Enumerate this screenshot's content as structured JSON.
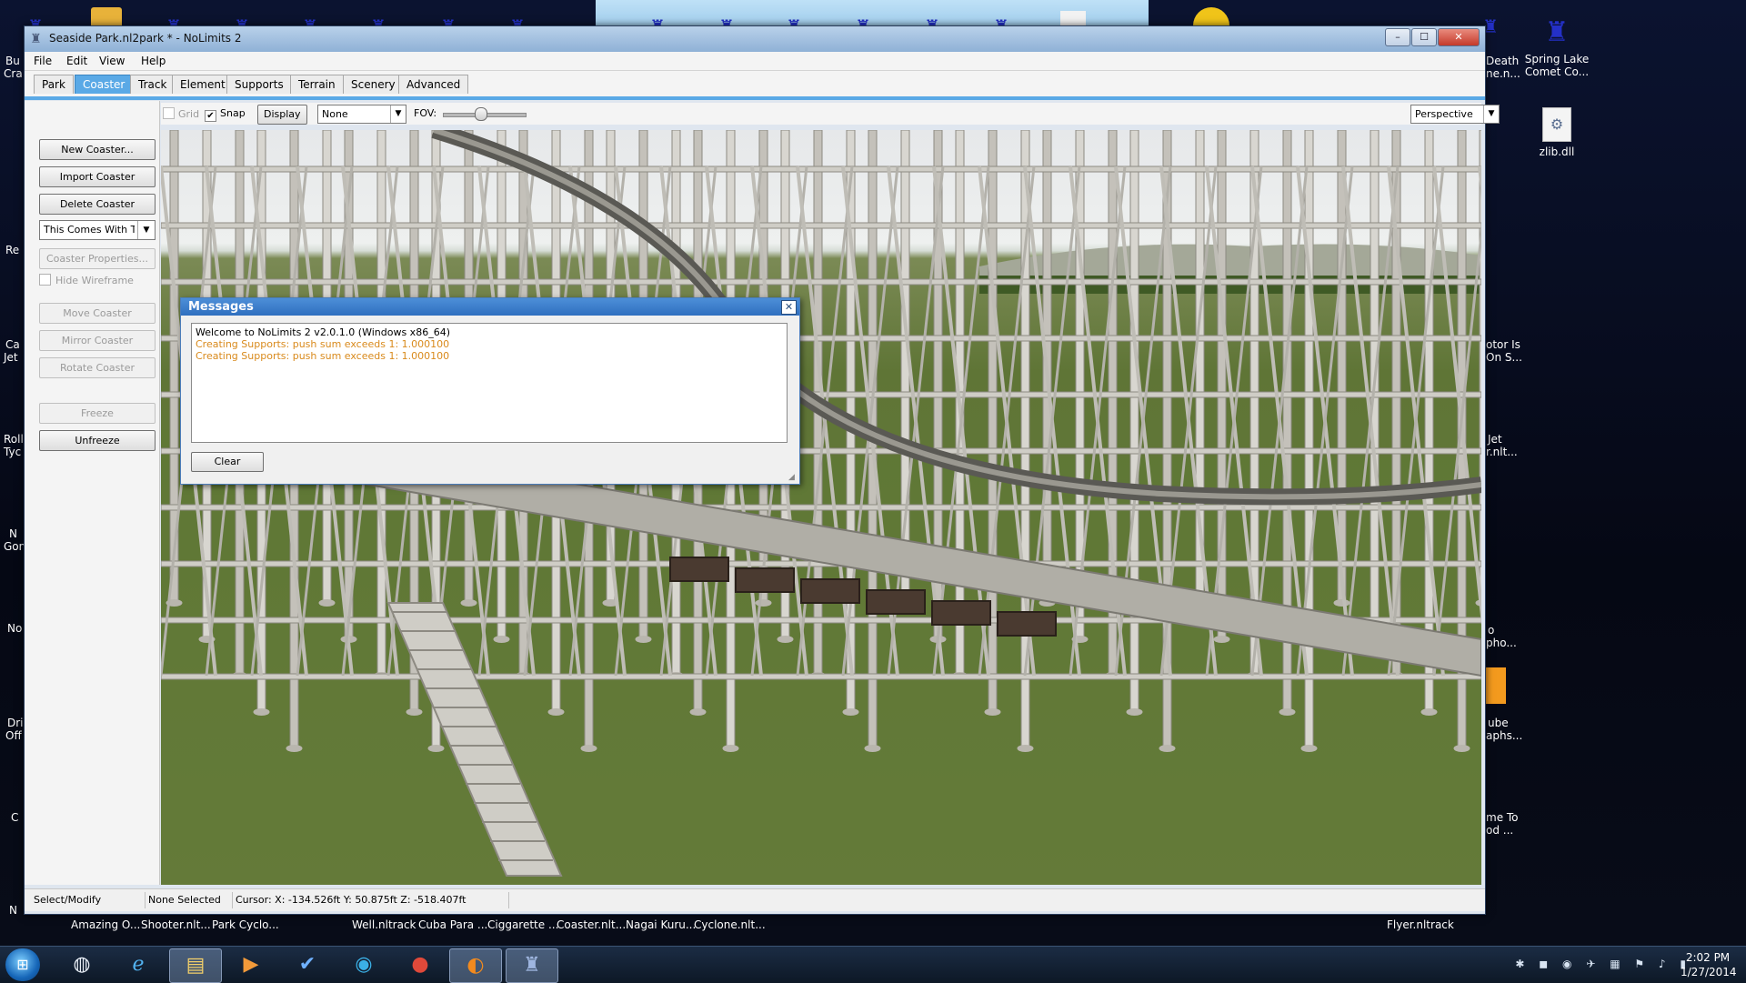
{
  "window": {
    "title": "Seaside Park.nl2park * - NoLimits 2"
  },
  "menu": [
    "File",
    "Edit",
    "View",
    "Help"
  ],
  "tabs": [
    {
      "label": "Park"
    },
    {
      "label": "Coaster",
      "active": true
    },
    {
      "label": "Track"
    },
    {
      "label": "Element"
    },
    {
      "label": "Supports"
    },
    {
      "label": "Terrain"
    },
    {
      "label": "Scenery"
    },
    {
      "label": "Advanced"
    }
  ],
  "left_panel": {
    "new_coaster": "New Coaster...",
    "import_coaster": "Import Coaster",
    "delete_coaster": "Delete Coaster",
    "coaster_select": "This Comes With T",
    "coaster_properties": "Coaster Properties...",
    "hide_wireframe": "Hide Wireframe",
    "move_coaster": "Move Coaster",
    "mirror_coaster": "Mirror Coaster",
    "rotate_coaster": "Rotate Coaster",
    "freeze": "Freeze",
    "unfreeze": "Unfreeze"
  },
  "viewport_toolbar": {
    "grid_label": "Grid",
    "grid_checked": false,
    "snap_label": "Snap",
    "snap_checked": true,
    "display_button": "Display",
    "none_select": "None",
    "fov_label": "FOV:",
    "fov_value": 0.45,
    "view_select": "Perspective"
  },
  "messages": {
    "title": "Messages",
    "lines": [
      {
        "text": "Welcome to NoLimits 2 v2.0.1.0 (Windows x86_64)",
        "type": "normal"
      },
      {
        "text": "Creating Supports: push sum exceeds 1: 1.000100",
        "type": "warn"
      },
      {
        "text": "Creating Supports: push sum exceeds 1: 1.000100",
        "type": "warn"
      }
    ],
    "clear_button": "Clear"
  },
  "status_bar": {
    "mode": "Select/Modify",
    "selection": "None Selected",
    "cursor": "Cursor:  X:  -134.526ft  Y:  50.875ft  Z:  -518.407ft"
  },
  "desktop": {
    "icons_right": [
      {
        "label": "Spring Lake Comet Co...",
        "icon": "castle-icon"
      },
      {
        "label": "zlib.dll",
        "icon": "dll-file-icon"
      }
    ],
    "partial_labels_right": [
      "Death",
      "ne.n...",
      "otor Is",
      "On S...",
      "Jet",
      "r.nlt...",
      "o",
      "pho...",
      "ube",
      "aphs...",
      "me To",
      "od ..."
    ],
    "partial_labels_left": [
      "Bu",
      "Cra",
      "Re",
      "Ca",
      "Jet",
      "Roll",
      "Tyc",
      "N",
      "Gon",
      "No",
      "Dri",
      "Off",
      "C",
      "N"
    ],
    "bottom_labels": [
      "Amazing O...",
      "Shooter.nlt...",
      "Park Cyclo...",
      "Well.nltrack",
      "Cuba Para ...",
      "Ciggarette ...",
      "Coaster.nlt...",
      "Nagai Kuru...",
      "Cyclone.nlt...",
      "Flyer.nltrack"
    ]
  },
  "taskbar": {
    "items": [
      "hp-icon",
      "internet-explorer-icon",
      "file-explorer-icon",
      "media-player-icon",
      "checkmark-app-icon",
      "globe-app-icon",
      "red-app-icon",
      "firefox-icon",
      "nolimits-icon"
    ],
    "time": "2:02 PM",
    "date": "1/27/2014"
  },
  "colors": {
    "accent": "#5aa9e6",
    "warning_text": "#d98a1c",
    "dialog_title": "#3b7fcc"
  }
}
